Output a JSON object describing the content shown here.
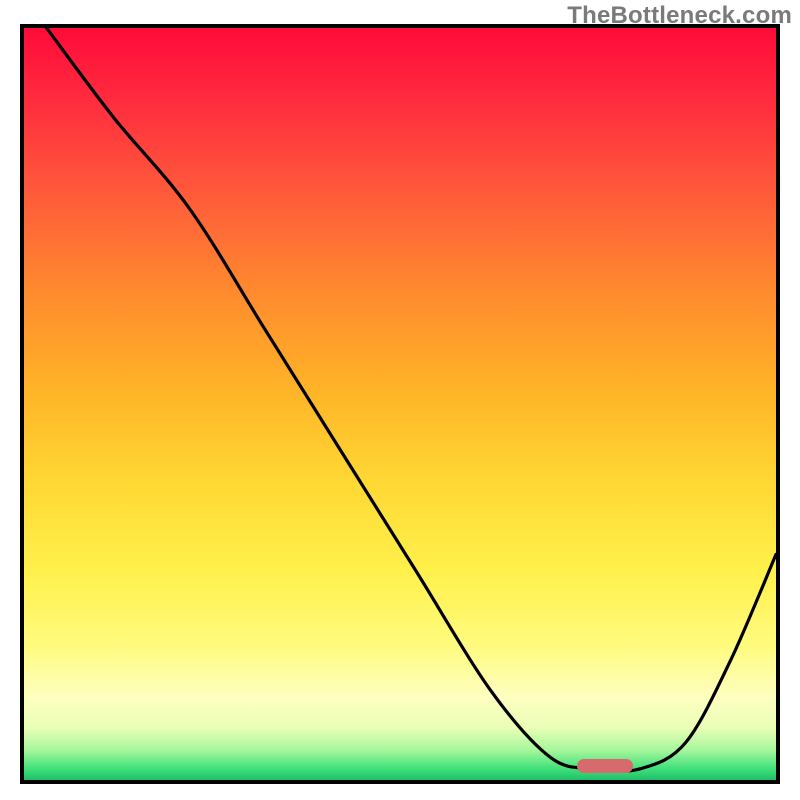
{
  "watermark": "TheBottleneck.com",
  "chart_data": {
    "type": "line",
    "title": "",
    "xlabel": "",
    "ylabel": "",
    "xlim": [
      0,
      1
    ],
    "ylim": [
      0,
      1
    ],
    "x": [
      0.03,
      0.12,
      0.22,
      0.32,
      0.42,
      0.52,
      0.62,
      0.7,
      0.76,
      0.82,
      0.88,
      0.94,
      1.0
    ],
    "values": [
      1.0,
      0.88,
      0.76,
      0.6,
      0.44,
      0.28,
      0.12,
      0.03,
      0.015,
      0.015,
      0.05,
      0.16,
      0.3
    ],
    "marker": {
      "x_start": 0.735,
      "x_end": 0.81,
      "y": 0.018
    },
    "colors": {
      "curve": "#000000",
      "marker": "#d66a6c",
      "frame": "#000000"
    }
  }
}
